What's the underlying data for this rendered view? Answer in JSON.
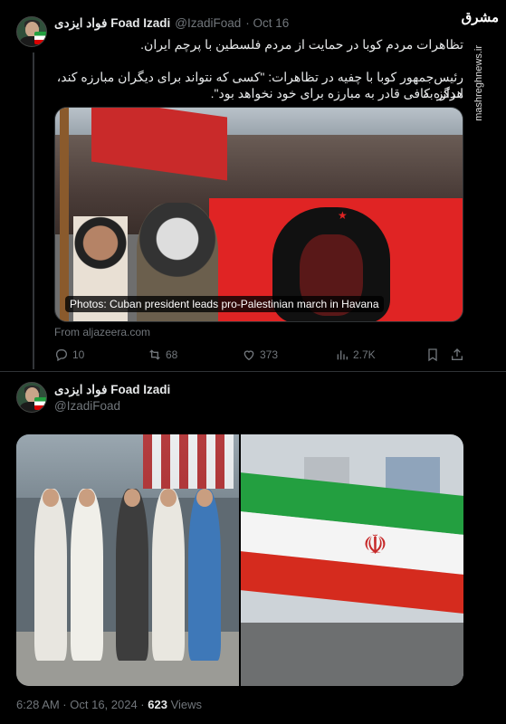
{
  "tweet1": {
    "display_name": "فواد ایزدی Foad Izadi",
    "handle": "@IzadiFoad",
    "date": "· Oct 16",
    "text_line1": "تظاهرات مردم کوبا در حمایت از مردم فلسطین با پرچم ایران.",
    "text_line2": "رئیس‌جمهور کوبا با چفیه در تظاهرات: \"کسی که نتواند برای دیگران مبارزه کند، هرگز به",
    "text_line3": "اندازه کافی قادر به مبارزه برای خود نخواهد بود\".",
    "image_caption": "Photos: Cuban president leads pro-Palestinian march in Havana",
    "source": "From aljazeera.com",
    "replies": "10",
    "reposts": "68",
    "likes": "373",
    "views": "2.7K"
  },
  "tweet2": {
    "display_name": "فواد ایزدی Foad Izadi",
    "handle": "@IzadiFoad",
    "time": "6:28 AM · Oct 16, 2024 · ",
    "views_count": "623",
    "views_label": " Views"
  },
  "watermark": {
    "logo": "مشرق",
    "site": "mashreghnews.ir"
  }
}
